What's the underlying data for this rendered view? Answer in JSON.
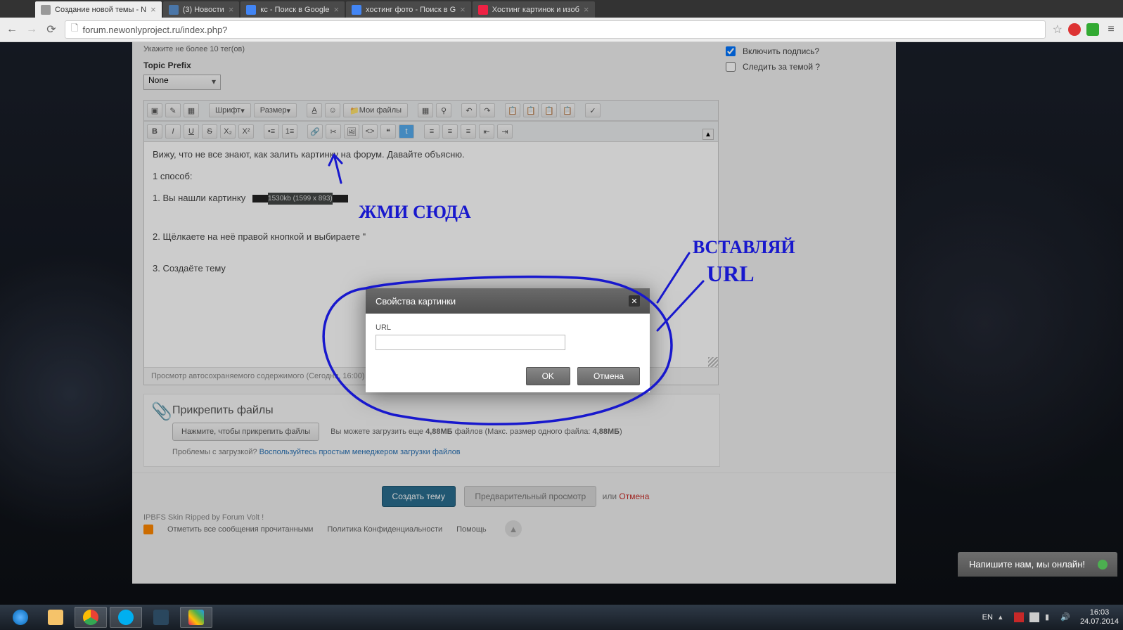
{
  "window": {
    "controls": {
      "min": "—",
      "max": "▢",
      "close": "✕"
    }
  },
  "tabs": [
    {
      "title": "Создание новой темы - N",
      "active": true
    },
    {
      "title": "(3) Новости",
      "active": false
    },
    {
      "title": "кс - Поиск в Google",
      "active": false
    },
    {
      "title": "хостинг фото - Поиск в G",
      "active": false
    },
    {
      "title": "Хостинг картинок и изоб",
      "active": false
    }
  ],
  "url": "forum.newonlyproject.ru/index.php?",
  "form": {
    "tag_hint": "Укажите не более 10 тег(ов)",
    "prefix_label": "Topic Prefix",
    "prefix_value": "None"
  },
  "toolbar": {
    "font_label": "Шрифт",
    "size_label": "Размер",
    "myfiles": "Мои файлы"
  },
  "content": {
    "intro": "Вижу, что не все знают, как залить картинку на форум. Давайте объясню.",
    "method": "1 способ:",
    "step1": "1. Вы нашли картинку",
    "thumb_meta": "1530kb (1599 x 893)",
    "step2": "2. Щёлкаете на неё правой кнопкой и выбираете \"",
    "step3": "3. Создаёте тему"
  },
  "autosave": "Просмотр автосохраняемого содержимого (Сегодня, 16:00) · Последнее автосохранение: 16:03:20",
  "sidebar": {
    "opt1": "Включить подпись?",
    "opt2": "Следить за темой ?",
    "opt1_checked": true,
    "opt2_checked": false
  },
  "attach": {
    "title": "Прикрепить файлы",
    "button": "Нажмите, чтобы прикрепить файлы",
    "info_pre": "Вы можете загрузить еще ",
    "info_size1": "4,88МБ",
    "info_mid": " файлов (Макс. размер одного файла: ",
    "info_size2": "4,88МБ",
    "info_post": ")",
    "help_q": "Проблемы с загрузкой? ",
    "help_link": "Воспользуйтесь простым менеджером загрузки файлов"
  },
  "actions": {
    "create": "Создать тему",
    "preview": "Предварительный просмотр",
    "or": "или ",
    "cancel": "Отмена"
  },
  "footer": {
    "skin": "IPBFS Skin Ripped by Forum Volt !",
    "mark_read": "Отметить все сообщения прочитанными",
    "privacy": "Политика Конфиденциальности",
    "help": "Помощь"
  },
  "modal": {
    "title": "Свойства картинки",
    "url_label": "URL",
    "url_value": "",
    "ok": "OK",
    "cancel": "Отмена"
  },
  "chat": {
    "text": "Напишите нам, мы онлайн!"
  },
  "annotations": {
    "press_here": "ЖМИ СЮДА",
    "insert_url_1": "ВСТАВЛЯЙ",
    "insert_url_2": "URL"
  },
  "tray": {
    "lang": "EN",
    "time": "16:03",
    "date": "24.07.2014"
  }
}
